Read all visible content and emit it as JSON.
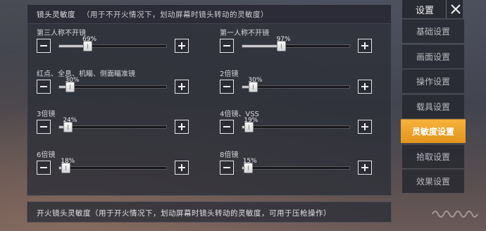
{
  "panel": {
    "title": "镜头灵敏度",
    "hint": "（用于不开火情况下，划动屏幕时镜头转动的灵敏度）"
  },
  "sliders": [
    {
      "label": "第三人称不开镜",
      "value": "69%",
      "level": 0.26
    },
    {
      "label": "第一人称不开镜",
      "value": "97%",
      "level": 0.36
    },
    {
      "label": "红点、全息、机瞄、侧面瞄准镜",
      "value": "30%",
      "level": 0.1
    },
    {
      "label": "2倍镜",
      "value": "30%",
      "level": 0.1
    },
    {
      "label": "3倍镜",
      "value": "24%",
      "level": 0.08
    },
    {
      "label": "4倍镜、VSS",
      "value": "19%",
      "level": 0.06
    },
    {
      "label": "6倍镜",
      "value": "18%",
      "level": 0.06
    },
    {
      "label": "8倍镜",
      "value": "15%",
      "level": 0.05
    }
  ],
  "fire_section": {
    "text": "开火镜头灵敏度（用于开火情况下，划动屏幕时镜头转动的灵敏度，可用于压枪操作）"
  },
  "sidebar": {
    "title": "设置",
    "items": [
      {
        "label": "基础设置",
        "active": false
      },
      {
        "label": "画面设置",
        "active": false
      },
      {
        "label": "操作设置",
        "active": false
      },
      {
        "label": "载具设置",
        "active": false
      },
      {
        "label": "灵敏度设置",
        "active": true
      },
      {
        "label": "拾取设置",
        "active": false
      },
      {
        "label": "效果设置",
        "active": false
      }
    ]
  },
  "colors": {
    "accent": "#f0a22e",
    "panel_bg": "#2d2f38"
  }
}
